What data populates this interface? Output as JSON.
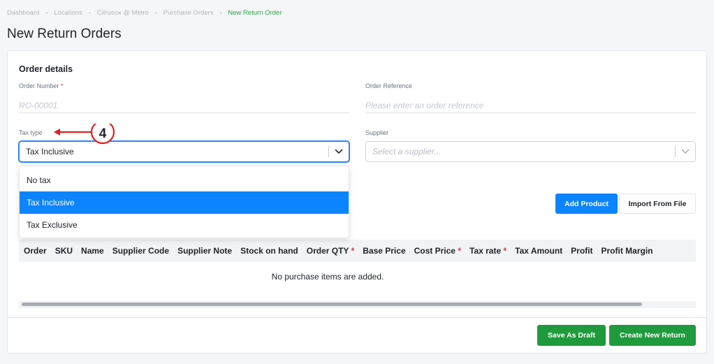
{
  "breadcrumb": [
    "Dashboard",
    "Locations",
    "Citrusox @ Metro",
    "Purchase Orders",
    "New Return Order"
  ],
  "page_title": "New Return Orders",
  "section_title": "Order details",
  "order_number": {
    "label": "Order Number",
    "required_mark": "*",
    "placeholder": "RO-00001"
  },
  "order_reference": {
    "label": "Order Reference",
    "placeholder": "Please enter an order reference"
  },
  "tax_type": {
    "label": "Tax type",
    "value": "Tax Inclusive",
    "options": [
      "No tax",
      "Tax Inclusive",
      "Tax Exclusive"
    ]
  },
  "supplier": {
    "label": "Supplier",
    "placeholder": "Select a supplier..."
  },
  "annotation": "4",
  "actions": {
    "add_product": "Add Product",
    "import_file": "Import From File"
  },
  "table": {
    "columns": [
      {
        "label": "Order"
      },
      {
        "label": "SKU"
      },
      {
        "label": "Name"
      },
      {
        "label": "Supplier Code"
      },
      {
        "label": "Supplier Note"
      },
      {
        "label": "Stock on hand"
      },
      {
        "label": "Order QTY",
        "req": "*"
      },
      {
        "label": "Base Price"
      },
      {
        "label": "Cost Price",
        "req": "*"
      },
      {
        "label": "Tax rate",
        "req": "*"
      },
      {
        "label": "Tax Amount"
      },
      {
        "label": "Profit"
      },
      {
        "label": "Profit Margin"
      }
    ],
    "empty_message": "No purchase items are added."
  },
  "footer": {
    "save_draft": "Save As Draft",
    "create_return": "Create New Return"
  },
  "colors": {
    "primary": "#0d84ff",
    "success": "#1f9a3c",
    "required": "#dc3545",
    "annotation": "#e02020",
    "breadcrumb_active": "#28a745"
  }
}
